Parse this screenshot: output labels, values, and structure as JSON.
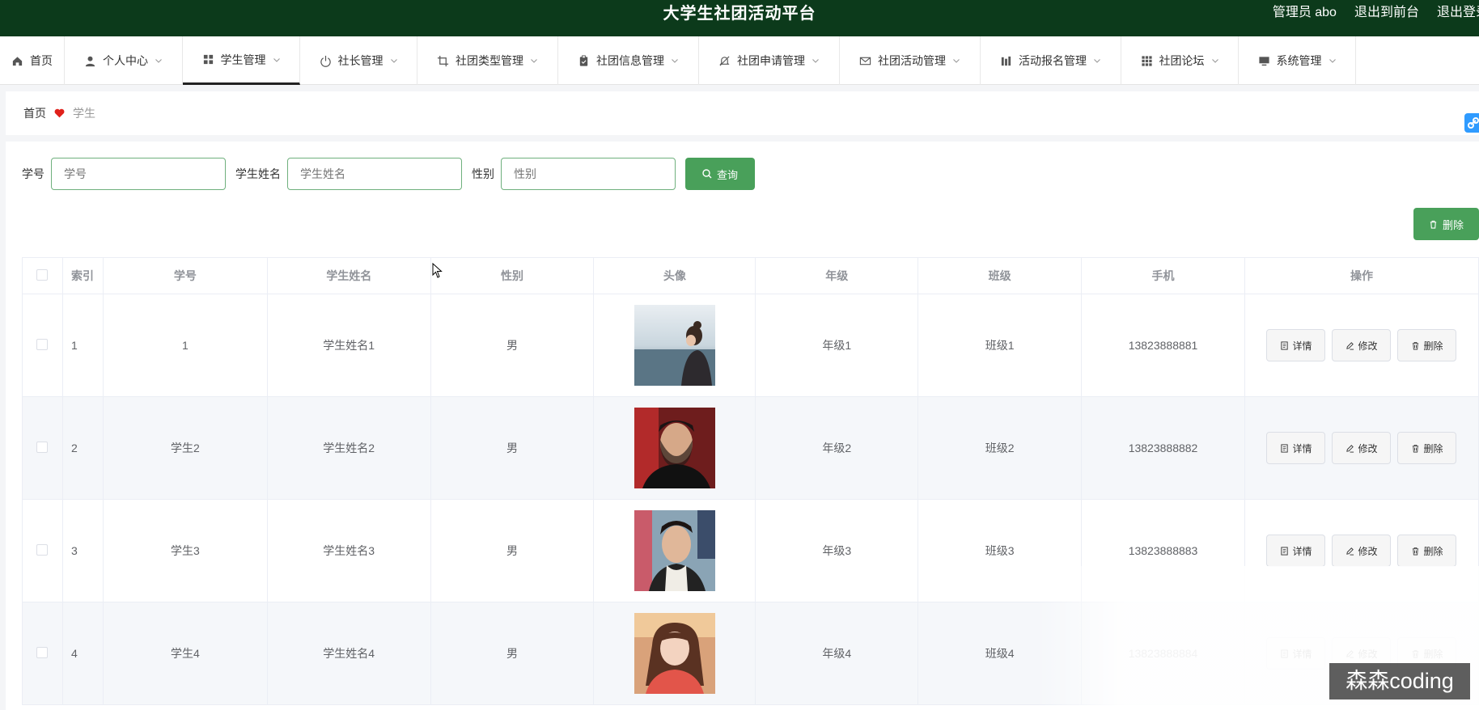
{
  "header": {
    "title": "大学生社团活动平台",
    "admin": "管理员 abo",
    "to_front": "退出到前台",
    "logout": "退出登录"
  },
  "nav": [
    {
      "label": "首页",
      "icon": "home-icon",
      "chevron": false,
      "width": 80
    },
    {
      "label": "个人中心",
      "icon": "user-icon",
      "chevron": true,
      "width": 146
    },
    {
      "label": "学生管理",
      "icon": "grid-icon",
      "chevron": true,
      "width": 145,
      "active": true
    },
    {
      "label": "社长管理",
      "icon": "power-icon",
      "chevron": true,
      "width": 145
    },
    {
      "label": "社团类型管理",
      "icon": "crop-icon",
      "chevron": true,
      "width": 174
    },
    {
      "label": "社团信息管理",
      "icon": "clipboard-icon",
      "chevron": true,
      "width": 174
    },
    {
      "label": "社团申请管理",
      "icon": "bell-off-icon",
      "chevron": true,
      "width": 174
    },
    {
      "label": "社团活动管理",
      "icon": "mail-icon",
      "chevron": true,
      "width": 174
    },
    {
      "label": "活动报名管理",
      "icon": "bars-icon",
      "chevron": true,
      "width": 174
    },
    {
      "label": "社团论坛",
      "icon": "apps-icon",
      "chevron": true,
      "width": 145
    },
    {
      "label": "系统管理",
      "icon": "monitor-icon",
      "chevron": true,
      "width": 145
    }
  ],
  "breadcrumb": {
    "home": "首页",
    "current": "学生"
  },
  "search": {
    "fields": [
      {
        "label": "学号",
        "placeholder": "学号"
      },
      {
        "label": "学生姓名",
        "placeholder": "学生姓名"
      },
      {
        "label": "性别",
        "placeholder": "性别"
      }
    ],
    "query_label": "查询"
  },
  "actions": {
    "delete_label": "删除"
  },
  "table": {
    "columns": [
      "索引",
      "学号",
      "学生姓名",
      "性别",
      "头像",
      "年级",
      "班级",
      "手机",
      "操作"
    ],
    "rows": [
      {
        "index": "1",
        "id": "1",
        "name": "学生姓名1",
        "gender": "男",
        "grade": "年级1",
        "class": "班级1",
        "phone": "13823888881"
      },
      {
        "index": "2",
        "id": "学生2",
        "name": "学生姓名2",
        "gender": "男",
        "grade": "年级2",
        "class": "班级2",
        "phone": "13823888882"
      },
      {
        "index": "3",
        "id": "学生3",
        "name": "学生姓名3",
        "gender": "男",
        "grade": "年级3",
        "class": "班级3",
        "phone": "13823888883"
      },
      {
        "index": "4",
        "id": "学生4",
        "name": "学生姓名4",
        "gender": "男",
        "grade": "年级4",
        "class": "班级4",
        "phone": "13823888884"
      }
    ],
    "row_actions": {
      "detail": "详情",
      "edit": "修改",
      "delete": "删除"
    }
  },
  "watermark": "森森coding",
  "colors": {
    "header_bg": "#0c3a1b",
    "primary_green": "#49a05a",
    "input_border": "#6fb07d"
  }
}
